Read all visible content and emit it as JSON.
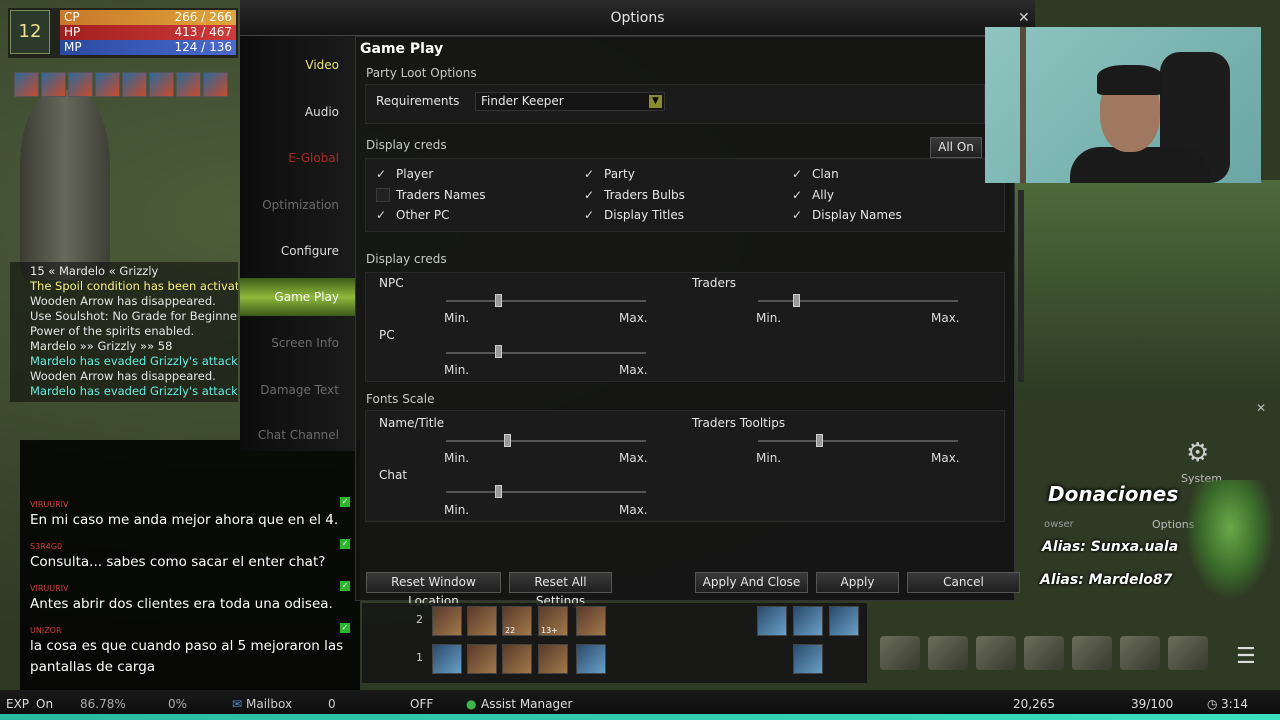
{
  "player": {
    "level": "12",
    "cp": {
      "label": "CP",
      "value": "266 / 266"
    },
    "hp": {
      "label": "HP",
      "value": "413 / 467"
    },
    "mp": {
      "label": "MP",
      "value": "124 / 136"
    }
  },
  "system_chat": [
    {
      "text": "15  «  Mardelo  «  Grizzly",
      "color": "c-wht"
    },
    {
      "text": "The Spoil condition has been activated",
      "color": "c-yel"
    },
    {
      "text": "Wooden Arrow has disappeared.",
      "color": "c-wht"
    },
    {
      "text": "Use Soulshot: No Grade for Beginners",
      "color": "c-wht"
    },
    {
      "text": "Power of the spirits enabled.",
      "color": "c-wht"
    },
    {
      "text": "Mardelo  »»  Grizzly  »»  58",
      "color": "c-wht"
    },
    {
      "text": "Mardelo has evaded Grizzly's attack.",
      "color": "c-cyan"
    },
    {
      "text": "Wooden Arrow has disappeared.",
      "color": "c-wht"
    },
    {
      "text": "Mardelo has evaded Grizzly's attack.",
      "color": "c-cyan"
    }
  ],
  "stream_chat": [
    {
      "user": "VIRUURIV",
      "text": "En mi caso me anda mejor ahora que en el 4."
    },
    {
      "user": "S3R4G0",
      "text": "Consulta... sabes como sacar el enter chat?"
    },
    {
      "user": "VIRUURIV",
      "text": "Antes abrir dos clientes era toda una odisea."
    },
    {
      "user": "UNIZOR",
      "text": "la cosa es que cuando paso al 5 mejoraron las pantallas de carga"
    }
  ],
  "window": {
    "title": "Options"
  },
  "tabs": [
    "Video",
    "Audio",
    "E-Global",
    "Optimization",
    "Configure",
    "Game Play",
    "Screen Info",
    "Damage Text",
    "Chat Channel"
  ],
  "panel": {
    "title": "Game Play",
    "party_loot": {
      "heading": "Party Loot Options",
      "req_label": "Requirements",
      "req_value": "Finder Keeper"
    },
    "display1": {
      "heading": "Display creds",
      "all_on": "All On",
      "items": [
        {
          "label": "Player",
          "checked": true
        },
        {
          "label": "Party",
          "checked": true
        },
        {
          "label": "Clan",
          "checked": true
        },
        {
          "label": "Traders Names",
          "checked": false
        },
        {
          "label": "Traders Bulbs",
          "checked": true
        },
        {
          "label": "Ally",
          "checked": true
        },
        {
          "label": "Other PC",
          "checked": true
        },
        {
          "label": "Display Titles",
          "checked": true
        },
        {
          "label": "Display Names",
          "checked": true
        }
      ]
    },
    "display2": {
      "heading": "Display creds",
      "npc": "NPC",
      "traders": "Traders",
      "pc": "PC",
      "min": "Min.",
      "max": "Max."
    },
    "fonts": {
      "heading": "Fonts Scale",
      "name_title": "Name/Title",
      "traders_tooltips": "Traders Tooltips",
      "chat": "Chat",
      "min": "Min.",
      "max": "Max."
    }
  },
  "buttons": {
    "reset_window": "Reset Window Location",
    "reset_all": "Reset All Settings",
    "apply_close": "Apply And Close",
    "apply": "Apply",
    "cancel": "Cancel"
  },
  "overlay": {
    "donations": "Donaciones",
    "alias1": "Alias: Sunxa.uala",
    "alias2": "Alias: Mardelo87",
    "system": "System",
    "options": "Options",
    "browser": "owser"
  },
  "hotbar": {
    "row1": "2",
    "row2": "1",
    "slot_count": "22",
    "slot_count2": "13+"
  },
  "bottom": {
    "exp": "EXP",
    "exp_on": "On",
    "exp_pct": "86.78%",
    "pct2": "0%",
    "mailbox": "Mailbox",
    "mail_count": "0",
    "off": "OFF",
    "assist": "Assist Manager",
    "adena": "20,265",
    "weight": "39/100",
    "time": "3:14"
  }
}
